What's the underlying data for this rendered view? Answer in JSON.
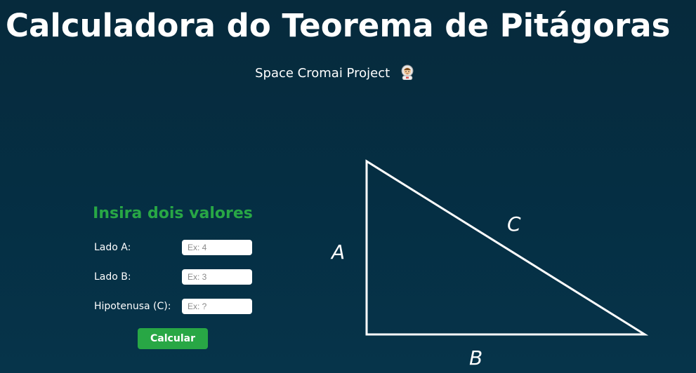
{
  "header": {
    "title": "Calculadora do Teorema de Pitágoras",
    "subtitle": "Space Cromai Project",
    "subtitle_icon": "astronaut-emoji-icon"
  },
  "form": {
    "heading": "Insira dois valores",
    "fields": [
      {
        "label": "Lado A:",
        "placeholder": "Ex: 4",
        "value": ""
      },
      {
        "label": "Lado B:",
        "placeholder": "Ex: 3",
        "value": ""
      },
      {
        "label": "Hipotenusa (C):",
        "placeholder": "Ex: ?",
        "value": ""
      }
    ],
    "button_label": "Calcular"
  },
  "diagram": {
    "label_a": "A",
    "label_b": "B",
    "label_c": "C"
  },
  "colors": {
    "background": "#052f44",
    "accent_green": "#28a745",
    "text": "#ffffff"
  }
}
